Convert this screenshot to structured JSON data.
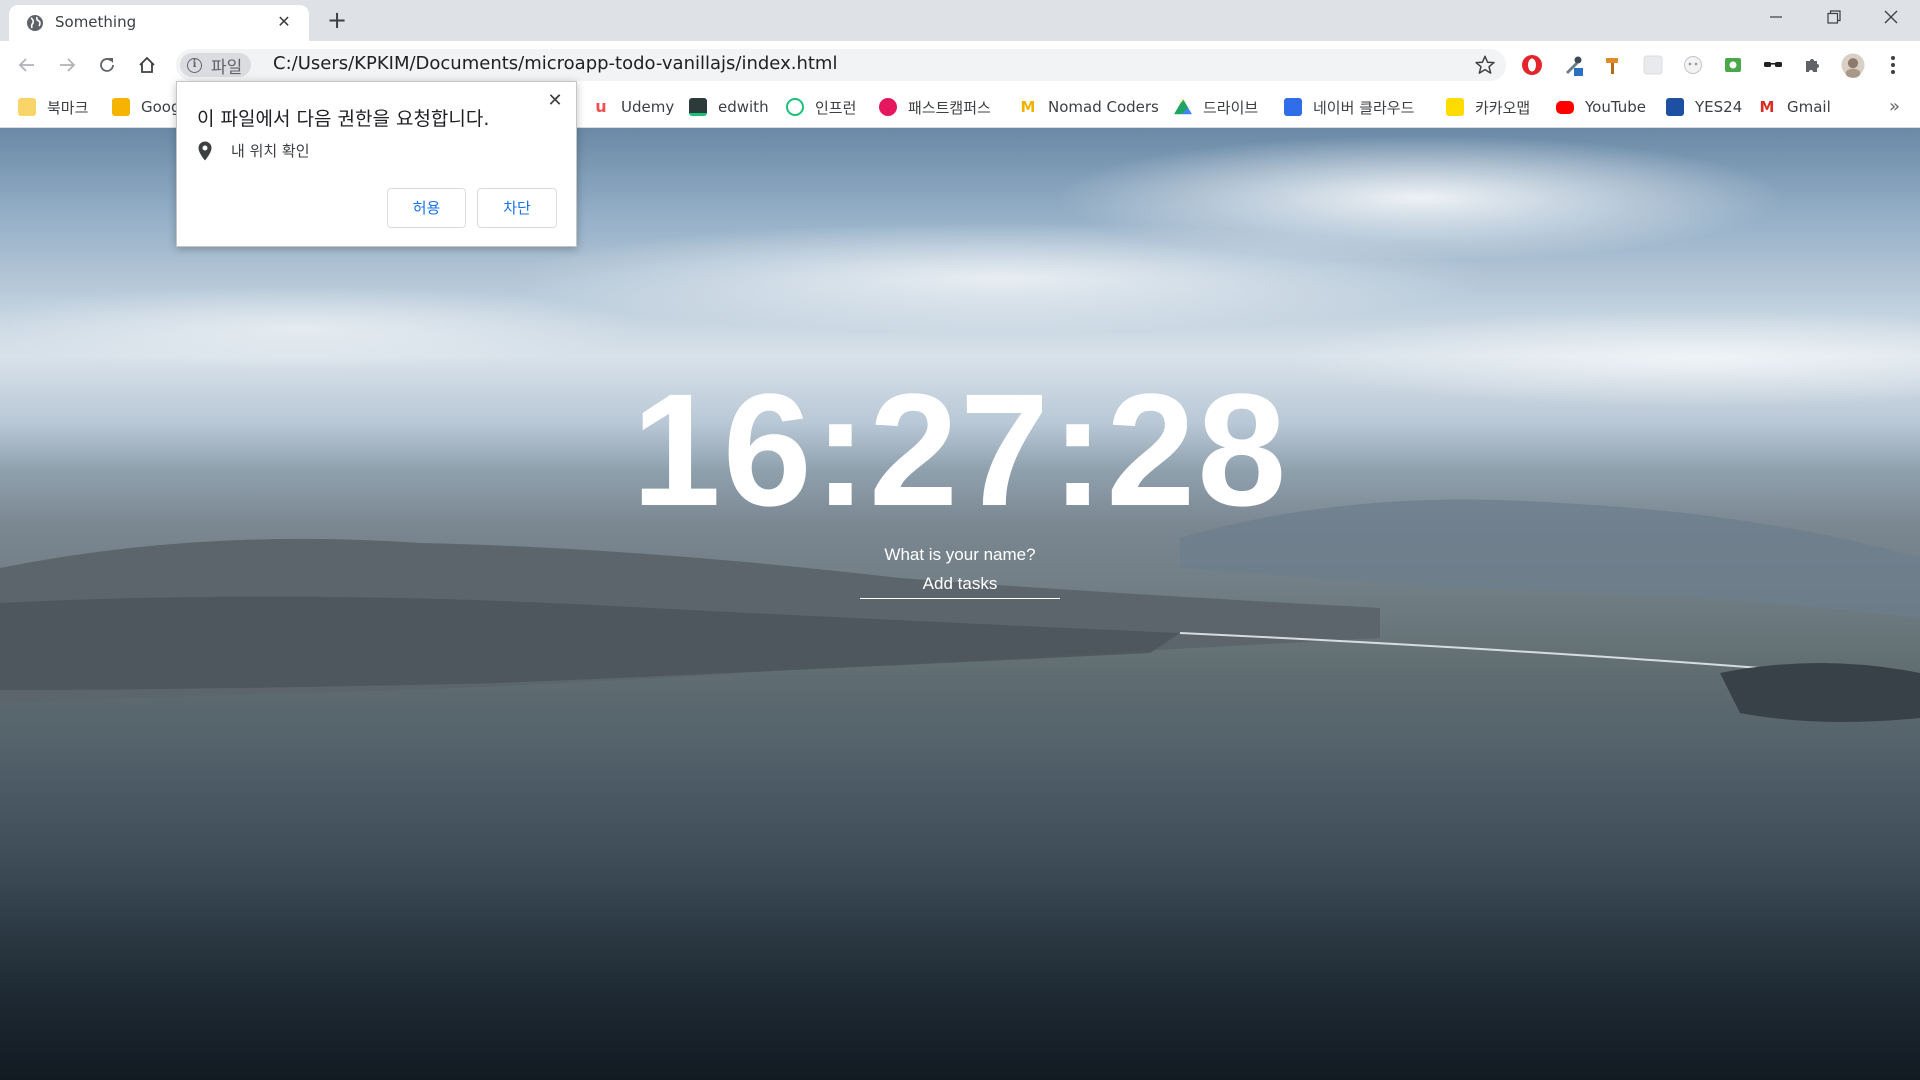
{
  "browser": {
    "tab": {
      "title": "Something",
      "favicon": "globe-icon",
      "close": "✕"
    },
    "new_tab": "+",
    "window_controls": {
      "minimize": "minimize-icon",
      "restore": "restore-icon",
      "close": "close-icon"
    },
    "toolbar": {
      "back": "back-icon",
      "forward": "forward-icon",
      "reload": "reload-icon",
      "home": "home-icon",
      "security_chip": {
        "icon": "info-icon",
        "label": "파일"
      },
      "url": "C:/Users/KPKIM/Documents/microapp-todo-vanillajs/index.html",
      "bookmark_star": "star-icon"
    },
    "bookmarks": [
      {
        "label": "북마크",
        "icon": "folder-icon",
        "color": "#f9d468"
      },
      {
        "label": "Goog",
        "icon": "keep-icon",
        "color": "#f6b400"
      },
      {
        "label": "Udemy",
        "icon": "udemy-icon",
        "color": "#ec5252"
      },
      {
        "label": "edwith",
        "icon": "edwith-icon",
        "color": "#2d3a3a"
      },
      {
        "label": "인프런",
        "icon": "inflearn-icon",
        "color": "#1dc078"
      },
      {
        "label": "패스트캠퍼스",
        "icon": "fastcampus-icon",
        "color": "#e5175e"
      },
      {
        "label": "Nomad Coders",
        "icon": "nomad-icon",
        "color": "#f0b400"
      },
      {
        "label": "드라이브",
        "icon": "drive-icon",
        "color": "#1fa463"
      },
      {
        "label": "네이버 클라우드",
        "icon": "cloud-icon",
        "color": "#2f6ee8"
      },
      {
        "label": "카카오맵",
        "icon": "map-pin-icon",
        "color": "#ffdc00"
      },
      {
        "label": "YouTube",
        "icon": "youtube-icon",
        "color": "#ff0000"
      },
      {
        "label": "YES24",
        "icon": "yes24-icon",
        "color": "#1e4fa3"
      },
      {
        "label": "Gmail",
        "icon": "gmail-icon",
        "color": "#d93025"
      }
    ],
    "bookmarks_overflow": "»"
  },
  "page": {
    "clock": "16:27:28",
    "name_prompt": "What is your name?",
    "task_placeholder": "Add tasks"
  },
  "permission_popup": {
    "title": "이 파일에서 다음 권한을 요청합니다.",
    "permission": "내 위치 확인",
    "allow": "허용",
    "block": "차단",
    "close": "✕"
  }
}
